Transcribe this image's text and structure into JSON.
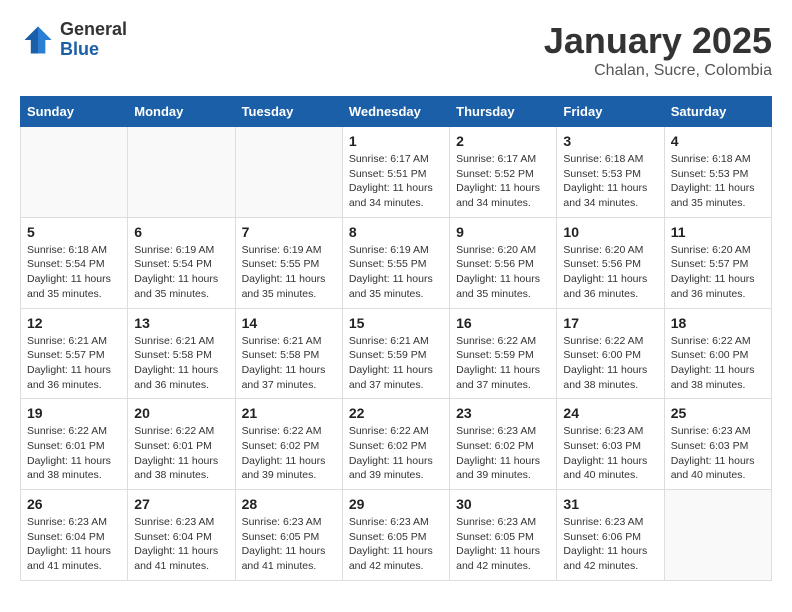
{
  "header": {
    "logo_general": "General",
    "logo_blue": "Blue",
    "month_title": "January 2025",
    "subtitle": "Chalan, Sucre, Colombia"
  },
  "weekdays": [
    "Sunday",
    "Monday",
    "Tuesday",
    "Wednesday",
    "Thursday",
    "Friday",
    "Saturday"
  ],
  "weeks": [
    [
      {
        "day": "",
        "info": ""
      },
      {
        "day": "",
        "info": ""
      },
      {
        "day": "",
        "info": ""
      },
      {
        "day": "1",
        "info": "Sunrise: 6:17 AM\nSunset: 5:51 PM\nDaylight: 11 hours\nand 34 minutes."
      },
      {
        "day": "2",
        "info": "Sunrise: 6:17 AM\nSunset: 5:52 PM\nDaylight: 11 hours\nand 34 minutes."
      },
      {
        "day": "3",
        "info": "Sunrise: 6:18 AM\nSunset: 5:53 PM\nDaylight: 11 hours\nand 34 minutes."
      },
      {
        "day": "4",
        "info": "Sunrise: 6:18 AM\nSunset: 5:53 PM\nDaylight: 11 hours\nand 35 minutes."
      }
    ],
    [
      {
        "day": "5",
        "info": "Sunrise: 6:18 AM\nSunset: 5:54 PM\nDaylight: 11 hours\nand 35 minutes."
      },
      {
        "day": "6",
        "info": "Sunrise: 6:19 AM\nSunset: 5:54 PM\nDaylight: 11 hours\nand 35 minutes."
      },
      {
        "day": "7",
        "info": "Sunrise: 6:19 AM\nSunset: 5:55 PM\nDaylight: 11 hours\nand 35 minutes."
      },
      {
        "day": "8",
        "info": "Sunrise: 6:19 AM\nSunset: 5:55 PM\nDaylight: 11 hours\nand 35 minutes."
      },
      {
        "day": "9",
        "info": "Sunrise: 6:20 AM\nSunset: 5:56 PM\nDaylight: 11 hours\nand 35 minutes."
      },
      {
        "day": "10",
        "info": "Sunrise: 6:20 AM\nSunset: 5:56 PM\nDaylight: 11 hours\nand 36 minutes."
      },
      {
        "day": "11",
        "info": "Sunrise: 6:20 AM\nSunset: 5:57 PM\nDaylight: 11 hours\nand 36 minutes."
      }
    ],
    [
      {
        "day": "12",
        "info": "Sunrise: 6:21 AM\nSunset: 5:57 PM\nDaylight: 11 hours\nand 36 minutes."
      },
      {
        "day": "13",
        "info": "Sunrise: 6:21 AM\nSunset: 5:58 PM\nDaylight: 11 hours\nand 36 minutes."
      },
      {
        "day": "14",
        "info": "Sunrise: 6:21 AM\nSunset: 5:58 PM\nDaylight: 11 hours\nand 37 minutes."
      },
      {
        "day": "15",
        "info": "Sunrise: 6:21 AM\nSunset: 5:59 PM\nDaylight: 11 hours\nand 37 minutes."
      },
      {
        "day": "16",
        "info": "Sunrise: 6:22 AM\nSunset: 5:59 PM\nDaylight: 11 hours\nand 37 minutes."
      },
      {
        "day": "17",
        "info": "Sunrise: 6:22 AM\nSunset: 6:00 PM\nDaylight: 11 hours\nand 38 minutes."
      },
      {
        "day": "18",
        "info": "Sunrise: 6:22 AM\nSunset: 6:00 PM\nDaylight: 11 hours\nand 38 minutes."
      }
    ],
    [
      {
        "day": "19",
        "info": "Sunrise: 6:22 AM\nSunset: 6:01 PM\nDaylight: 11 hours\nand 38 minutes."
      },
      {
        "day": "20",
        "info": "Sunrise: 6:22 AM\nSunset: 6:01 PM\nDaylight: 11 hours\nand 38 minutes."
      },
      {
        "day": "21",
        "info": "Sunrise: 6:22 AM\nSunset: 6:02 PM\nDaylight: 11 hours\nand 39 minutes."
      },
      {
        "day": "22",
        "info": "Sunrise: 6:22 AM\nSunset: 6:02 PM\nDaylight: 11 hours\nand 39 minutes."
      },
      {
        "day": "23",
        "info": "Sunrise: 6:23 AM\nSunset: 6:02 PM\nDaylight: 11 hours\nand 39 minutes."
      },
      {
        "day": "24",
        "info": "Sunrise: 6:23 AM\nSunset: 6:03 PM\nDaylight: 11 hours\nand 40 minutes."
      },
      {
        "day": "25",
        "info": "Sunrise: 6:23 AM\nSunset: 6:03 PM\nDaylight: 11 hours\nand 40 minutes."
      }
    ],
    [
      {
        "day": "26",
        "info": "Sunrise: 6:23 AM\nSunset: 6:04 PM\nDaylight: 11 hours\nand 41 minutes."
      },
      {
        "day": "27",
        "info": "Sunrise: 6:23 AM\nSunset: 6:04 PM\nDaylight: 11 hours\nand 41 minutes."
      },
      {
        "day": "28",
        "info": "Sunrise: 6:23 AM\nSunset: 6:05 PM\nDaylight: 11 hours\nand 41 minutes."
      },
      {
        "day": "29",
        "info": "Sunrise: 6:23 AM\nSunset: 6:05 PM\nDaylight: 11 hours\nand 42 minutes."
      },
      {
        "day": "30",
        "info": "Sunrise: 6:23 AM\nSunset: 6:05 PM\nDaylight: 11 hours\nand 42 minutes."
      },
      {
        "day": "31",
        "info": "Sunrise: 6:23 AM\nSunset: 6:06 PM\nDaylight: 11 hours\nand 42 minutes."
      },
      {
        "day": "",
        "info": ""
      }
    ]
  ]
}
